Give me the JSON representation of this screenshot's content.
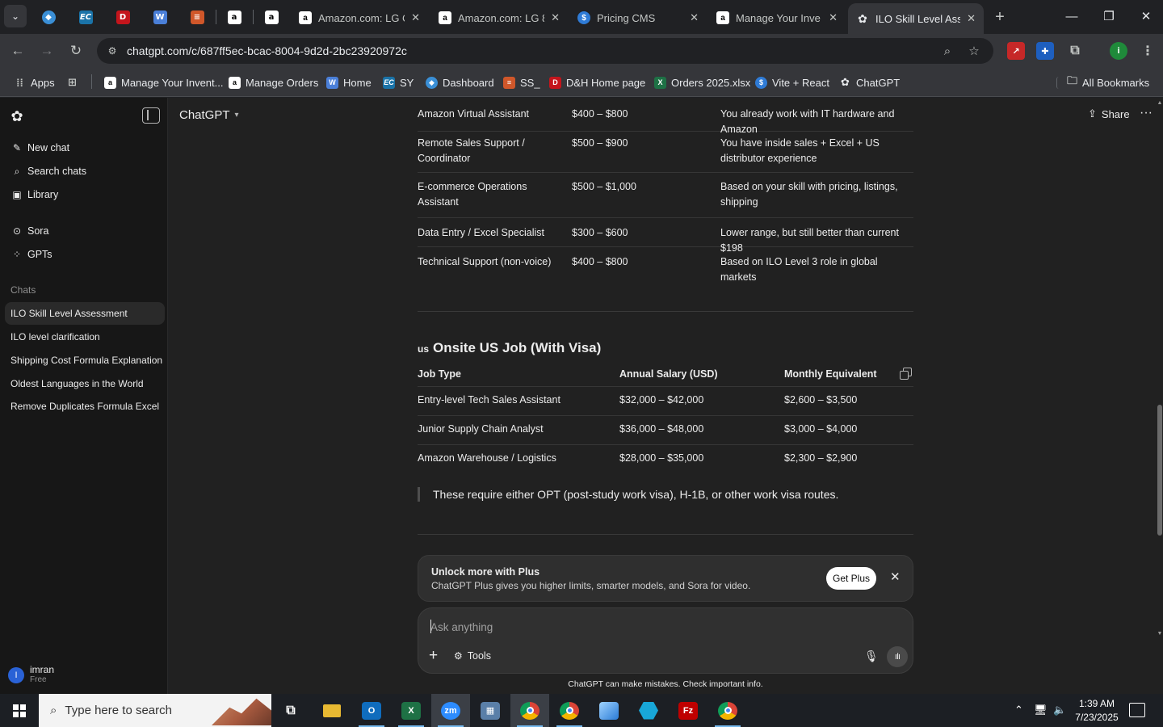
{
  "browser": {
    "tabs": [
      {
        "title": "Amazon.com: LG C",
        "favicon": "amazon-a"
      },
      {
        "title": "Amazon.com: LG 8",
        "favicon": "amazon-a"
      },
      {
        "title": "Pricing CMS",
        "favicon": "dollar"
      },
      {
        "title": "Manage Your Inve",
        "favicon": "amazon-a"
      },
      {
        "title": "ILO Skill Level Asse",
        "favicon": "chatgpt",
        "active": true
      }
    ],
    "url": "chatgpt.com/c/687ff5ec-bcac-8004-9d2d-2bc23920972c",
    "bookmarks": [
      {
        "label": "Apps"
      },
      {
        "label": "Manage Your Invent..."
      },
      {
        "label": "Manage Orders"
      },
      {
        "label": "Home"
      },
      {
        "label": "SY"
      },
      {
        "label": "Dashboard"
      },
      {
        "label": "SS_"
      },
      {
        "label": "D&H Home page"
      },
      {
        "label": "Orders 2025.xlsx"
      },
      {
        "label": "Vite + React"
      },
      {
        "label": "ChatGPT"
      }
    ],
    "all_bookmarks": "All Bookmarks",
    "profile_initial": "i"
  },
  "sidebar": {
    "nav": [
      {
        "label": "New chat",
        "icon": "edit-icon"
      },
      {
        "label": "Search chats",
        "icon": "search-icon"
      },
      {
        "label": "Library",
        "icon": "library-icon"
      },
      {
        "label": "Sora",
        "icon": "play-icon"
      },
      {
        "label": "GPTs",
        "icon": "grid-icon"
      }
    ],
    "chats_heading": "Chats",
    "chats": [
      {
        "label": "ILO Skill Level Assessment",
        "active": true
      },
      {
        "label": "ILO level clarification"
      },
      {
        "label": "Shipping Cost Formula Explanation"
      },
      {
        "label": "Oldest Languages in the World"
      },
      {
        "label": "Remove Duplicates Formula Excel"
      }
    ],
    "user": {
      "name": "imran",
      "plan": "Free",
      "initial": "I"
    }
  },
  "header": {
    "model": "ChatGPT",
    "share": "Share"
  },
  "remote_table": {
    "rows": [
      {
        "job": "Amazon Virtual Assistant",
        "salary": "$400 – $800",
        "note": "You already work with IT hardware and Amazon"
      },
      {
        "job": "Remote Sales Support / Coordinator",
        "salary": "$500 – $900",
        "note": "You have inside sales + Excel + US distributor experience"
      },
      {
        "job": "E-commerce Operations Assistant",
        "salary": "$500 – $1,000",
        "note": "Based on your skill with pricing, listings, shipping"
      },
      {
        "job": "Data Entry / Excel Specialist",
        "salary": "$300 – $600",
        "note": "Lower range, but still better than current $198"
      },
      {
        "job": "Technical Support (non-voice)",
        "salary": "$400 – $800",
        "note": "Based on ILO Level 3 role in global markets"
      }
    ]
  },
  "onsite_section": {
    "flag": "us",
    "heading": "Onsite US Job (With Visa)",
    "headers": [
      "Job Type",
      "Annual Salary (USD)",
      "Monthly Equivalent"
    ],
    "rows": [
      {
        "job": "Entry-level Tech Sales Assistant",
        "annual": "$32,000 – $42,000",
        "monthly": "$2,600 – $3,500"
      },
      {
        "job": "Junior Supply Chain Analyst",
        "annual": "$36,000 – $48,000",
        "monthly": "$3,000 – $4,000"
      },
      {
        "job": "Amazon Warehouse / Logistics",
        "annual": "$28,000 – $35,000",
        "monthly": "$2,300 – $2,900"
      }
    ],
    "quote": "These require either OPT (post-study work visa), H-1B, or other work visa routes."
  },
  "upsell": {
    "title": "Unlock more with Plus",
    "description": "ChatGPT Plus gives you higher limits, smarter models, and Sora for video.",
    "button": "Get Plus"
  },
  "composer": {
    "placeholder": "Ask anything",
    "tools": "Tools"
  },
  "disclaimer": "ChatGPT can make mistakes. Check important info.",
  "taskbar": {
    "search_placeholder": "Type here to search",
    "time": "1:39 AM",
    "date": "7/23/2025"
  }
}
